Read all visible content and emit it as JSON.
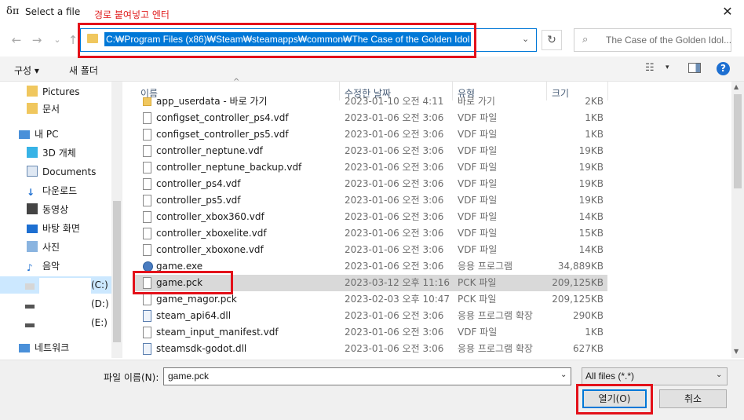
{
  "window": {
    "app_glyph": "δπ",
    "title": "Select a file",
    "close_glyph": "✕"
  },
  "annotation": {
    "label": "경로 붙여넣고 엔터",
    "color": "#e3111a"
  },
  "nav": {
    "back": "←",
    "forward": "→",
    "recent": "⌄",
    "up": "↑",
    "address": "C:₩Program Files (x86)₩Steam₩steamapps₩common₩The Case of the Golden Idol",
    "address_chevron": "⌄",
    "refresh": "↻",
    "search_icon": "⌕",
    "search_placeholder": "The Case of the Golden Idol..."
  },
  "toolbar": {
    "organize": "구성 ▾",
    "new_folder": "새 폴더",
    "view_icon": "☷",
    "view_chevron": "▾",
    "help": "?"
  },
  "sidebar": {
    "items": [
      {
        "label": "Pictures",
        "icon": "folder-icon"
      },
      {
        "label": "문서",
        "icon": "folder-icon"
      },
      {
        "label": "내 PC",
        "icon": "pc-icon"
      },
      {
        "label": "3D 개체",
        "icon": "cube-icon"
      },
      {
        "label": "Documents",
        "icon": "document-icon"
      },
      {
        "label": "다운로드",
        "icon": "download-icon"
      },
      {
        "label": "동영상",
        "icon": "video-icon"
      },
      {
        "label": "바탕 화면",
        "icon": "desktop-icon"
      },
      {
        "label": "사진",
        "icon": "pictures-icon"
      },
      {
        "label": "음악",
        "icon": "music-icon"
      },
      {
        "label": "(C:)",
        "icon": "drive-icon"
      },
      {
        "label": "(D:)",
        "icon": "drive-icon"
      },
      {
        "label": "(E:)",
        "icon": "drive-icon"
      },
      {
        "label": "네트워크",
        "icon": "network-icon"
      }
    ]
  },
  "list": {
    "columns": {
      "name": "이름",
      "date": "수정한 날짜",
      "type": "유형",
      "size": "크기"
    },
    "sort_indicator": "^",
    "rows": [
      {
        "name": "app_userdata - 바로 가기",
        "date": "2023-01-10 오전 4:11",
        "type": "바로 가기",
        "size": "2KB",
        "icon": "folder"
      },
      {
        "name": "configset_controller_ps4.vdf",
        "date": "2023-01-06 오전 3:06",
        "type": "VDF 파일",
        "size": "1KB",
        "icon": "file"
      },
      {
        "name": "configset_controller_ps5.vdf",
        "date": "2023-01-06 오전 3:06",
        "type": "VDF 파일",
        "size": "1KB",
        "icon": "file"
      },
      {
        "name": "controller_neptune.vdf",
        "date": "2023-01-06 오전 3:06",
        "type": "VDF 파일",
        "size": "19KB",
        "icon": "file"
      },
      {
        "name": "controller_neptune_backup.vdf",
        "date": "2023-01-06 오전 3:06",
        "type": "VDF 파일",
        "size": "19KB",
        "icon": "file"
      },
      {
        "name": "controller_ps4.vdf",
        "date": "2023-01-06 오전 3:06",
        "type": "VDF 파일",
        "size": "19KB",
        "icon": "file"
      },
      {
        "name": "controller_ps5.vdf",
        "date": "2023-01-06 오전 3:06",
        "type": "VDF 파일",
        "size": "19KB",
        "icon": "file"
      },
      {
        "name": "controller_xbox360.vdf",
        "date": "2023-01-06 오전 3:06",
        "type": "VDF 파일",
        "size": "14KB",
        "icon": "file"
      },
      {
        "name": "controller_xboxelite.vdf",
        "date": "2023-01-06 오전 3:06",
        "type": "VDF 파일",
        "size": "15KB",
        "icon": "file"
      },
      {
        "name": "controller_xboxone.vdf",
        "date": "2023-01-06 오전 3:06",
        "type": "VDF 파일",
        "size": "14KB",
        "icon": "file"
      },
      {
        "name": "game.exe",
        "date": "2023-01-06 오전 3:06",
        "type": "응용 프로그램",
        "size": "34,889KB",
        "icon": "exe"
      },
      {
        "name": "game.pck",
        "date": "2023-03-12 오후 11:16",
        "type": "PCK 파일",
        "size": "209,125KB",
        "icon": "file",
        "selected": true
      },
      {
        "name": "game_magor.pck",
        "date": "2023-02-03 오후 10:47",
        "type": "PCK 파일",
        "size": "209,125KB",
        "icon": "file"
      },
      {
        "name": "steam_api64.dll",
        "date": "2023-01-06 오전 3:06",
        "type": "응용 프로그램 확장",
        "size": "290KB",
        "icon": "dll"
      },
      {
        "name": "steam_input_manifest.vdf",
        "date": "2023-01-06 오전 3:06",
        "type": "VDF 파일",
        "size": "1KB",
        "icon": "file"
      },
      {
        "name": "steamsdk-godot.dll",
        "date": "2023-01-06 오전 3:06",
        "type": "응용 프로그램 확장",
        "size": "627KB",
        "icon": "dll"
      }
    ]
  },
  "footer": {
    "filename_label": "파일 이름(N):",
    "filename_value": "game.pck",
    "filter_value": "All files (*.*)",
    "open_label": "열기(O)",
    "cancel_label": "취소"
  }
}
